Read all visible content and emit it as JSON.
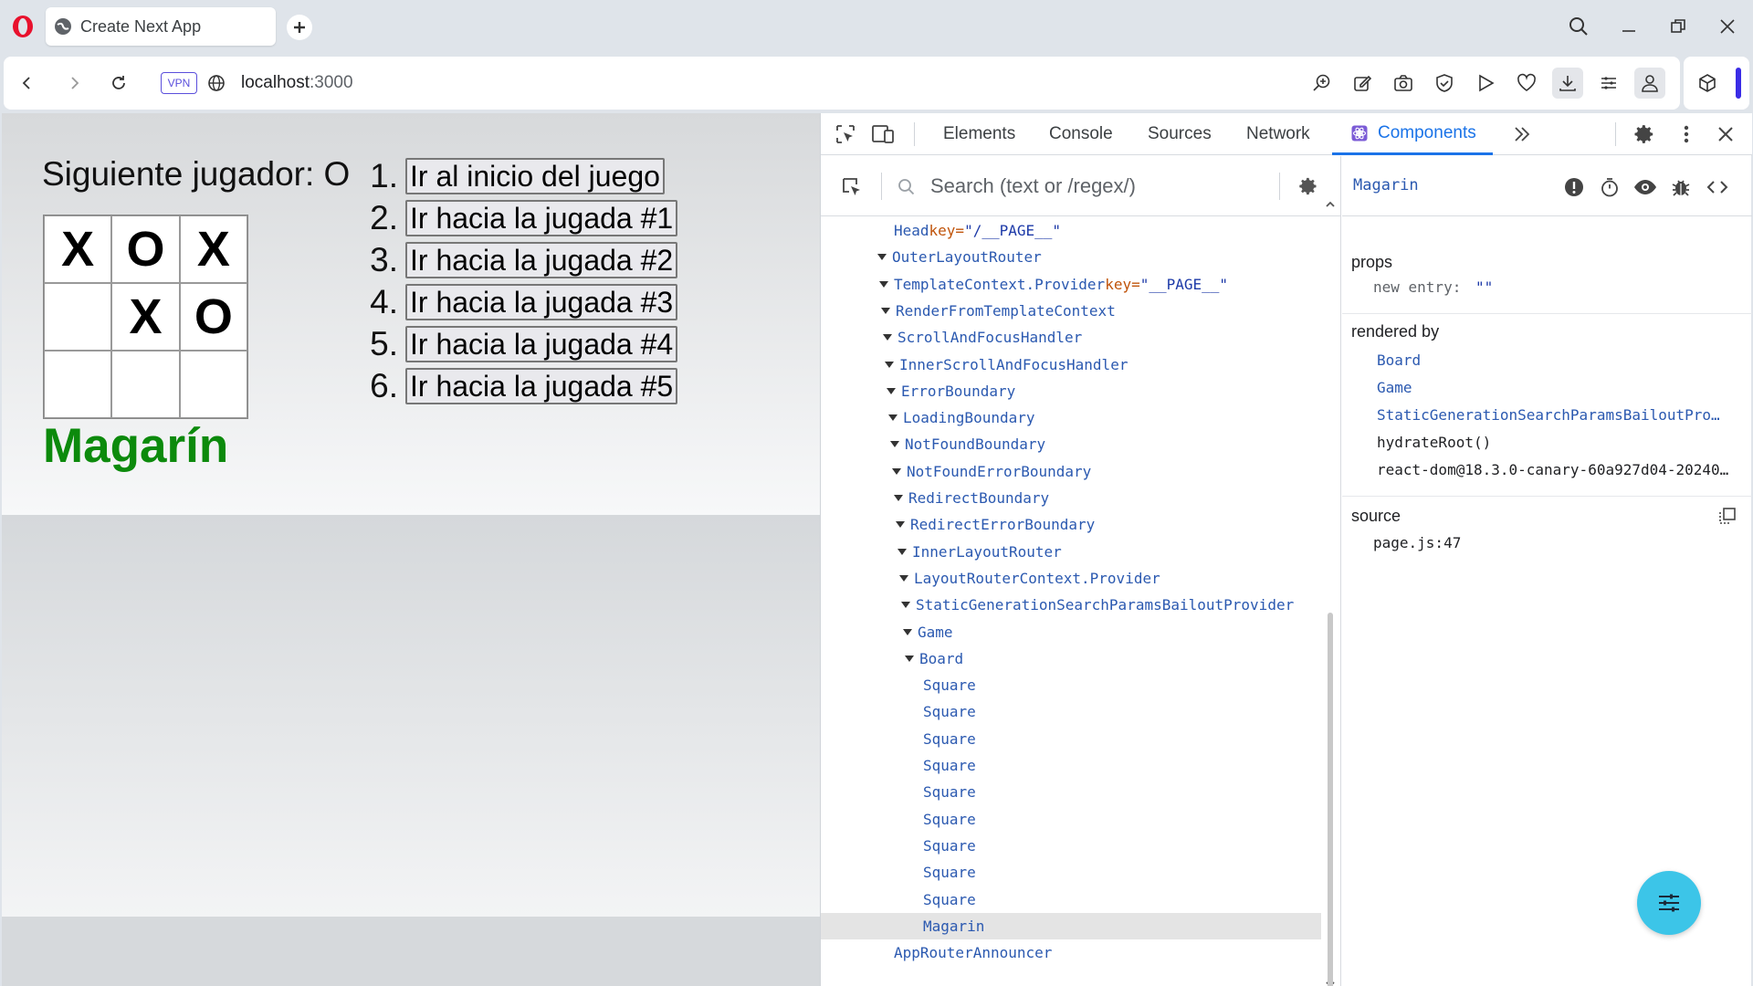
{
  "browser": {
    "tab_title": "Create Next App",
    "url_host": "localhost",
    "url_port": ":3000",
    "vpn_label": "VPN",
    "accent_color": "#3a2ce6"
  },
  "page": {
    "status": "Siguiente jugador: O",
    "board": [
      "X",
      "O",
      "X",
      "",
      "X",
      "O",
      "",
      "",
      ""
    ],
    "winner_label": "Magarín",
    "winner_color": "#0c8a0c",
    "moves": [
      {
        "num": "1.",
        "label": "Ir al inicio del juego"
      },
      {
        "num": "2.",
        "label": "Ir hacia la jugada #1"
      },
      {
        "num": "3.",
        "label": "Ir hacia la jugada #2"
      },
      {
        "num": "4.",
        "label": "Ir hacia la jugada #3"
      },
      {
        "num": "5.",
        "label": "Ir hacia la jugada #4"
      },
      {
        "num": "6.",
        "label": "Ir hacia la jugada #5"
      }
    ]
  },
  "devtools": {
    "tabs": [
      "Elements",
      "Console",
      "Sources",
      "Network",
      "Components"
    ],
    "active_tab": "Components",
    "search_placeholder": "Search (text or /regex/)",
    "tree": [
      {
        "label": "Head",
        "key_name": "key=",
        "key_value": "\"/__PAGE__\"",
        "expand": false
      },
      {
        "label": "OuterLayoutRouter",
        "expand": true
      },
      {
        "label": "TemplateContext.Provider",
        "key_name": "key=",
        "key_value": "\"__PAGE__\"",
        "expand": true
      },
      {
        "label": "RenderFromTemplateContext",
        "expand": true
      },
      {
        "label": "ScrollAndFocusHandler",
        "expand": true
      },
      {
        "label": "InnerScrollAndFocusHandler",
        "expand": true
      },
      {
        "label": "ErrorBoundary",
        "expand": true
      },
      {
        "label": "LoadingBoundary",
        "expand": true
      },
      {
        "label": "NotFoundBoundary",
        "expand": true
      },
      {
        "label": "NotFoundErrorBoundary",
        "expand": true
      },
      {
        "label": "RedirectBoundary",
        "expand": true
      },
      {
        "label": "RedirectErrorBoundary",
        "expand": true
      },
      {
        "label": "InnerLayoutRouter",
        "expand": true
      },
      {
        "label": "LayoutRouterContext.Provider",
        "expand": true
      },
      {
        "label": "StaticGenerationSearchParamsBailoutProvider",
        "expand": true
      },
      {
        "label": "Game",
        "expand": true
      },
      {
        "label": "Board",
        "expand": true
      },
      {
        "label": "Square",
        "expand": false
      },
      {
        "label": "Square",
        "expand": false
      },
      {
        "label": "Square",
        "expand": false
      },
      {
        "label": "Square",
        "expand": false
      },
      {
        "label": "Square",
        "expand": false
      },
      {
        "label": "Square",
        "expand": false
      },
      {
        "label": "Square",
        "expand": false
      },
      {
        "label": "Square",
        "expand": false
      },
      {
        "label": "Square",
        "expand": false
      },
      {
        "label": "Magarin",
        "expand": false,
        "selected": true
      },
      {
        "label": "AppRouterAnnouncer",
        "expand": false
      }
    ],
    "selected_component": "Magarin",
    "props_label": "props",
    "prop_name": "new entry:",
    "prop_value": "\"\"",
    "rendered_by_label": "rendered by",
    "rendered_by": [
      "Board",
      "Game",
      "StaticGenerationSearchParamsBailoutPro…",
      "hydrateRoot()",
      "react-dom@18.3.0-canary-60a927d04-20240…"
    ],
    "source_label": "source",
    "source_value": "page.js:47"
  }
}
